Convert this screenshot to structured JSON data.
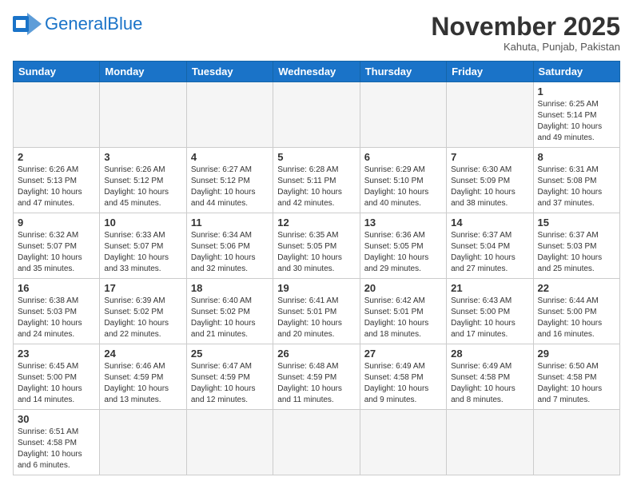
{
  "logo": {
    "text_general": "General",
    "text_blue": "Blue"
  },
  "header": {
    "month": "November 2025",
    "location": "Kahuta, Punjab, Pakistan"
  },
  "weekdays": [
    "Sunday",
    "Monday",
    "Tuesday",
    "Wednesday",
    "Thursday",
    "Friday",
    "Saturday"
  ],
  "weeks": [
    [
      {
        "day": "",
        "empty": true
      },
      {
        "day": "",
        "empty": true
      },
      {
        "day": "",
        "empty": true
      },
      {
        "day": "",
        "empty": true
      },
      {
        "day": "",
        "empty": true
      },
      {
        "day": "",
        "empty": true
      },
      {
        "day": "1",
        "rise": "6:25 AM",
        "set": "5:14 PM",
        "light": "10 hours and 49 minutes."
      }
    ],
    [
      {
        "day": "2",
        "rise": "6:26 AM",
        "set": "5:13 PM",
        "light": "10 hours and 47 minutes."
      },
      {
        "day": "3",
        "rise": "6:26 AM",
        "set": "5:12 PM",
        "light": "10 hours and 45 minutes."
      },
      {
        "day": "4",
        "rise": "6:27 AM",
        "set": "5:12 PM",
        "light": "10 hours and 44 minutes."
      },
      {
        "day": "5",
        "rise": "6:28 AM",
        "set": "5:11 PM",
        "light": "10 hours and 42 minutes."
      },
      {
        "day": "6",
        "rise": "6:29 AM",
        "set": "5:10 PM",
        "light": "10 hours and 40 minutes."
      },
      {
        "day": "7",
        "rise": "6:30 AM",
        "set": "5:09 PM",
        "light": "10 hours and 38 minutes."
      },
      {
        "day": "8",
        "rise": "6:31 AM",
        "set": "5:08 PM",
        "light": "10 hours and 37 minutes."
      }
    ],
    [
      {
        "day": "9",
        "rise": "6:32 AM",
        "set": "5:07 PM",
        "light": "10 hours and 35 minutes."
      },
      {
        "day": "10",
        "rise": "6:33 AM",
        "set": "5:07 PM",
        "light": "10 hours and 33 minutes."
      },
      {
        "day": "11",
        "rise": "6:34 AM",
        "set": "5:06 PM",
        "light": "10 hours and 32 minutes."
      },
      {
        "day": "12",
        "rise": "6:35 AM",
        "set": "5:05 PM",
        "light": "10 hours and 30 minutes."
      },
      {
        "day": "13",
        "rise": "6:36 AM",
        "set": "5:05 PM",
        "light": "10 hours and 29 minutes."
      },
      {
        "day": "14",
        "rise": "6:37 AM",
        "set": "5:04 PM",
        "light": "10 hours and 27 minutes."
      },
      {
        "day": "15",
        "rise": "6:37 AM",
        "set": "5:03 PM",
        "light": "10 hours and 25 minutes."
      }
    ],
    [
      {
        "day": "16",
        "rise": "6:38 AM",
        "set": "5:03 PM",
        "light": "10 hours and 24 minutes."
      },
      {
        "day": "17",
        "rise": "6:39 AM",
        "set": "5:02 PM",
        "light": "10 hours and 22 minutes."
      },
      {
        "day": "18",
        "rise": "6:40 AM",
        "set": "5:02 PM",
        "light": "10 hours and 21 minutes."
      },
      {
        "day": "19",
        "rise": "6:41 AM",
        "set": "5:01 PM",
        "light": "10 hours and 20 minutes."
      },
      {
        "day": "20",
        "rise": "6:42 AM",
        "set": "5:01 PM",
        "light": "10 hours and 18 minutes."
      },
      {
        "day": "21",
        "rise": "6:43 AM",
        "set": "5:00 PM",
        "light": "10 hours and 17 minutes."
      },
      {
        "day": "22",
        "rise": "6:44 AM",
        "set": "5:00 PM",
        "light": "10 hours and 16 minutes."
      }
    ],
    [
      {
        "day": "23",
        "rise": "6:45 AM",
        "set": "5:00 PM",
        "light": "10 hours and 14 minutes."
      },
      {
        "day": "24",
        "rise": "6:46 AM",
        "set": "4:59 PM",
        "light": "10 hours and 13 minutes."
      },
      {
        "day": "25",
        "rise": "6:47 AM",
        "set": "4:59 PM",
        "light": "10 hours and 12 minutes."
      },
      {
        "day": "26",
        "rise": "6:48 AM",
        "set": "4:59 PM",
        "light": "10 hours and 11 minutes."
      },
      {
        "day": "27",
        "rise": "6:49 AM",
        "set": "4:58 PM",
        "light": "10 hours and 9 minutes."
      },
      {
        "day": "28",
        "rise": "6:49 AM",
        "set": "4:58 PM",
        "light": "10 hours and 8 minutes."
      },
      {
        "day": "29",
        "rise": "6:50 AM",
        "set": "4:58 PM",
        "light": "10 hours and 7 minutes."
      }
    ],
    [
      {
        "day": "30",
        "rise": "6:51 AM",
        "set": "4:58 PM",
        "light": "10 hours and 6 minutes."
      },
      {
        "day": "",
        "empty": true
      },
      {
        "day": "",
        "empty": true
      },
      {
        "day": "",
        "empty": true
      },
      {
        "day": "",
        "empty": true
      },
      {
        "day": "",
        "empty": true
      },
      {
        "day": "",
        "empty": true
      }
    ]
  ],
  "labels": {
    "sunrise": "Sunrise:",
    "sunset": "Sunset:",
    "daylight": "Daylight:"
  }
}
